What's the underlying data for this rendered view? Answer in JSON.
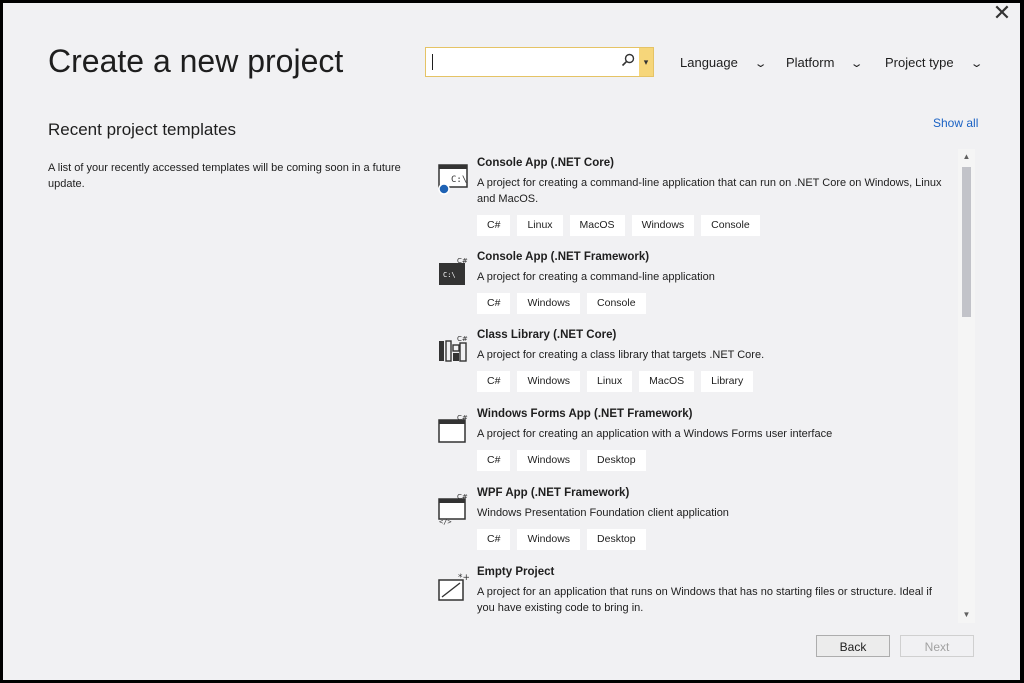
{
  "window": {
    "title": "Create a new project",
    "close_glyph": "✕"
  },
  "search": {
    "value": "",
    "icon": "search-icon",
    "dropdown_glyph": "▾"
  },
  "filters": [
    {
      "label": "Language",
      "chevron": "⌄"
    },
    {
      "label": "Platform",
      "chevron": "⌄"
    },
    {
      "label": "Project type",
      "chevron": "⌄"
    }
  ],
  "recent": {
    "heading": "Recent project templates",
    "message": "A list of your recently accessed templates will be coming soon in a future update."
  },
  "show_all": "Show all",
  "templates": [
    {
      "name": "Console App (.NET Core)",
      "icon": "console-app-core-icon",
      "description": "A project for creating a command-line application that can run on .NET Core on Windows, Linux and MacOS.",
      "tags": [
        "C#",
        "Linux",
        "MacOS",
        "Windows",
        "Console"
      ]
    },
    {
      "name": "Console App (.NET Framework)",
      "icon": "console-app-framework-icon",
      "description": "A project for creating a command-line application",
      "tags": [
        "C#",
        "Windows",
        "Console"
      ]
    },
    {
      "name": "Class Library (.NET Core)",
      "icon": "class-library-icon",
      "description": "A project for creating a class library that targets .NET Core.",
      "tags": [
        "C#",
        "Windows",
        "Linux",
        "MacOS",
        "Library"
      ]
    },
    {
      "name": "Windows Forms App (.NET Framework)",
      "icon": "windows-forms-icon",
      "description": "A project for creating an application with a Windows Forms user interface",
      "tags": [
        "C#",
        "Windows",
        "Desktop"
      ]
    },
    {
      "name": "WPF App (.NET Framework)",
      "icon": "wpf-app-icon",
      "description": "Windows Presentation Foundation client application",
      "tags": [
        "C#",
        "Windows",
        "Desktop"
      ]
    },
    {
      "name": "Empty Project",
      "icon": "empty-project-icon",
      "description": "A project for an application that runs on Windows that has no starting files or structure. Ideal if you have existing code to bring in.",
      "tags": []
    }
  ],
  "buttons": {
    "back": "Back",
    "next": "Next"
  },
  "colors": {
    "accent_link": "#1a62c4",
    "search_border": "#e5c365",
    "background": "#f1f1f3"
  }
}
